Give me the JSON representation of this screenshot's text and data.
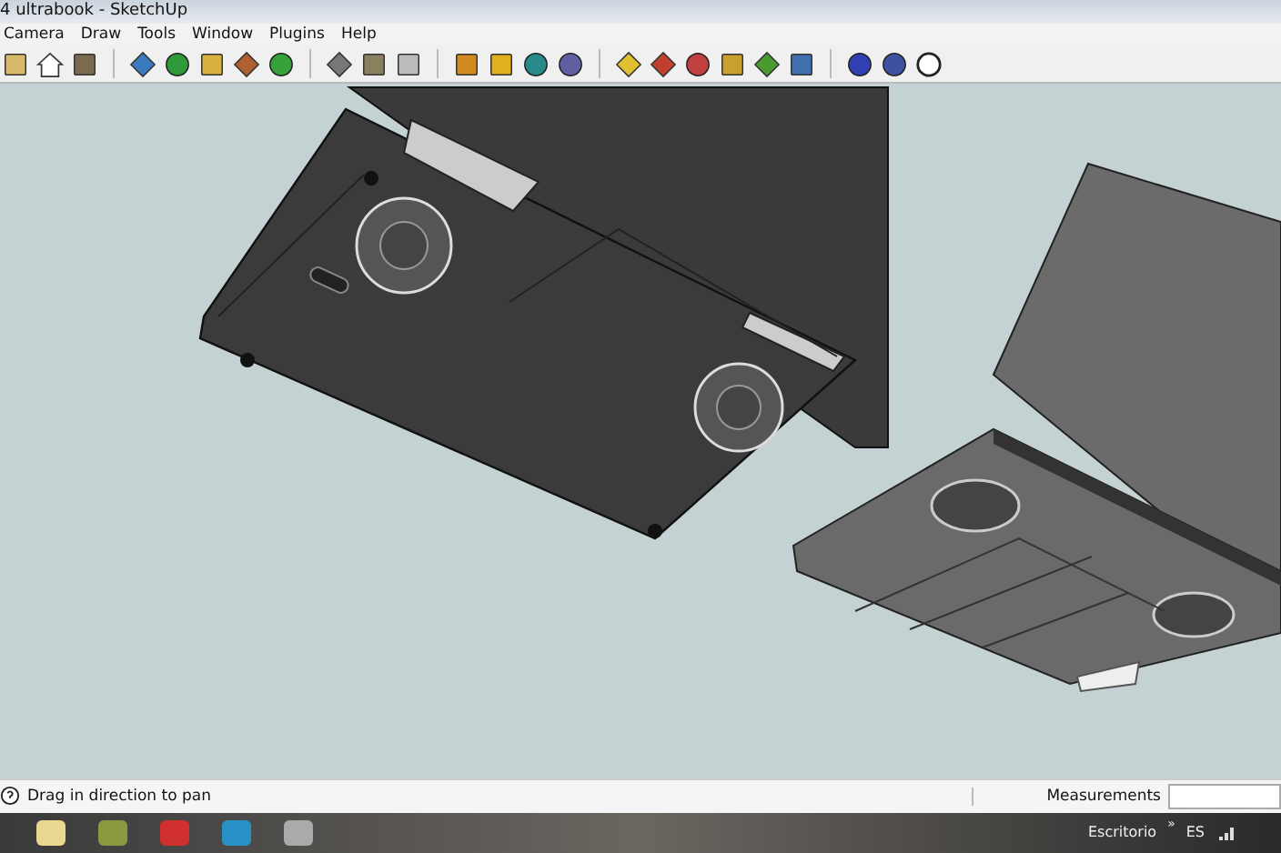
{
  "window": {
    "title": "4 ultrabook - SketchUp"
  },
  "menu": [
    "Camera",
    "Draw",
    "Tools",
    "Window",
    "Plugins",
    "Help"
  ],
  "status_bar": {
    "hint": "Drag in direction to pan",
    "measurements_label": "Measurements"
  },
  "taskbar": {
    "desktop_label": "Escritorio",
    "overflow": "»",
    "language": "ES"
  }
}
